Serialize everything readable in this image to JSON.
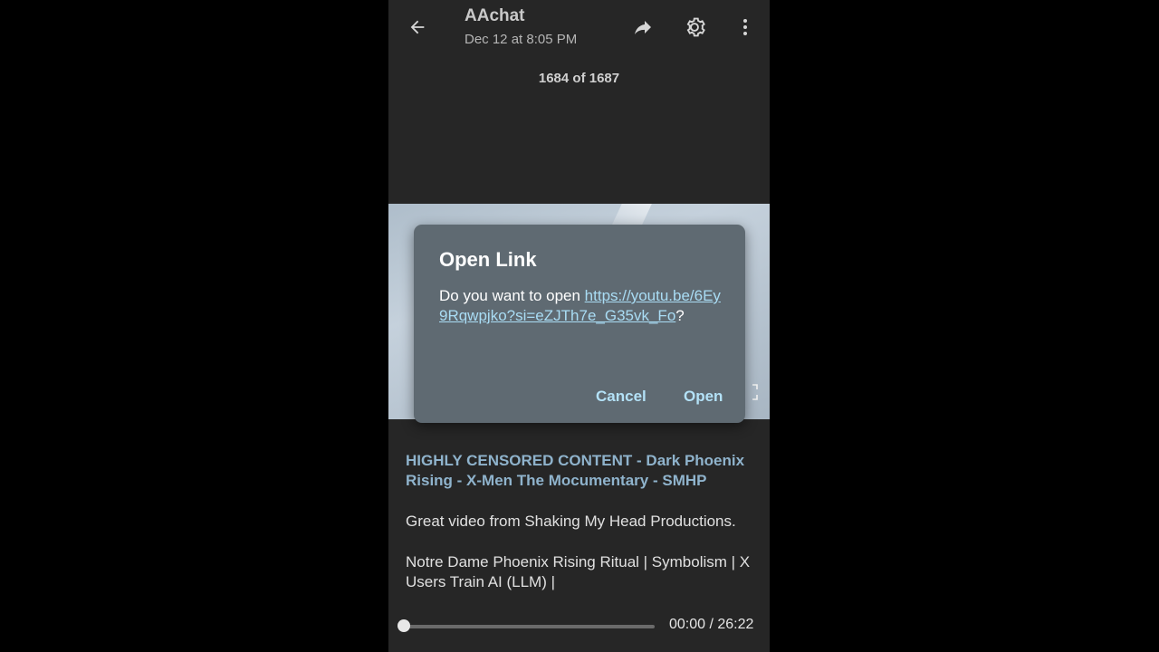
{
  "header": {
    "title": "AAchat",
    "subtitle": "Dec 12 at 8:05 PM"
  },
  "icons": {
    "back": "arrow-left-icon",
    "share": "share-forward-icon",
    "settings": "gear-icon",
    "more": "more-vertical-icon",
    "fullscreen": "fullscreen-icon"
  },
  "counter": "1684 of 1687",
  "dialog": {
    "title": "Open Link",
    "prompt": "Do you want to open ",
    "url": "https://youtu.be/6Ey9Rqwpjko?si=eZJTh7e_G35vk_Fo",
    "suffix": "?",
    "cancel_label": "Cancel",
    "open_label": "Open"
  },
  "caption": {
    "link_title": "HIGHLY CENSORED CONTENT - Dark Phoenix Rising - X-Men The Mocumentary - SMHP",
    "paragraph1": "Great video from Shaking My Head Productions.",
    "paragraph2": "Notre Dame Phoenix Rising Ritual | Symbolism | X Users Train AI (LLM) |"
  },
  "player": {
    "progress": 0,
    "time": "00:00 / 26:22"
  },
  "colors": {
    "background": "#262626",
    "dialog": "#5f6a72",
    "link": "#a9dcf4",
    "caption_link": "#8fb3cc"
  }
}
